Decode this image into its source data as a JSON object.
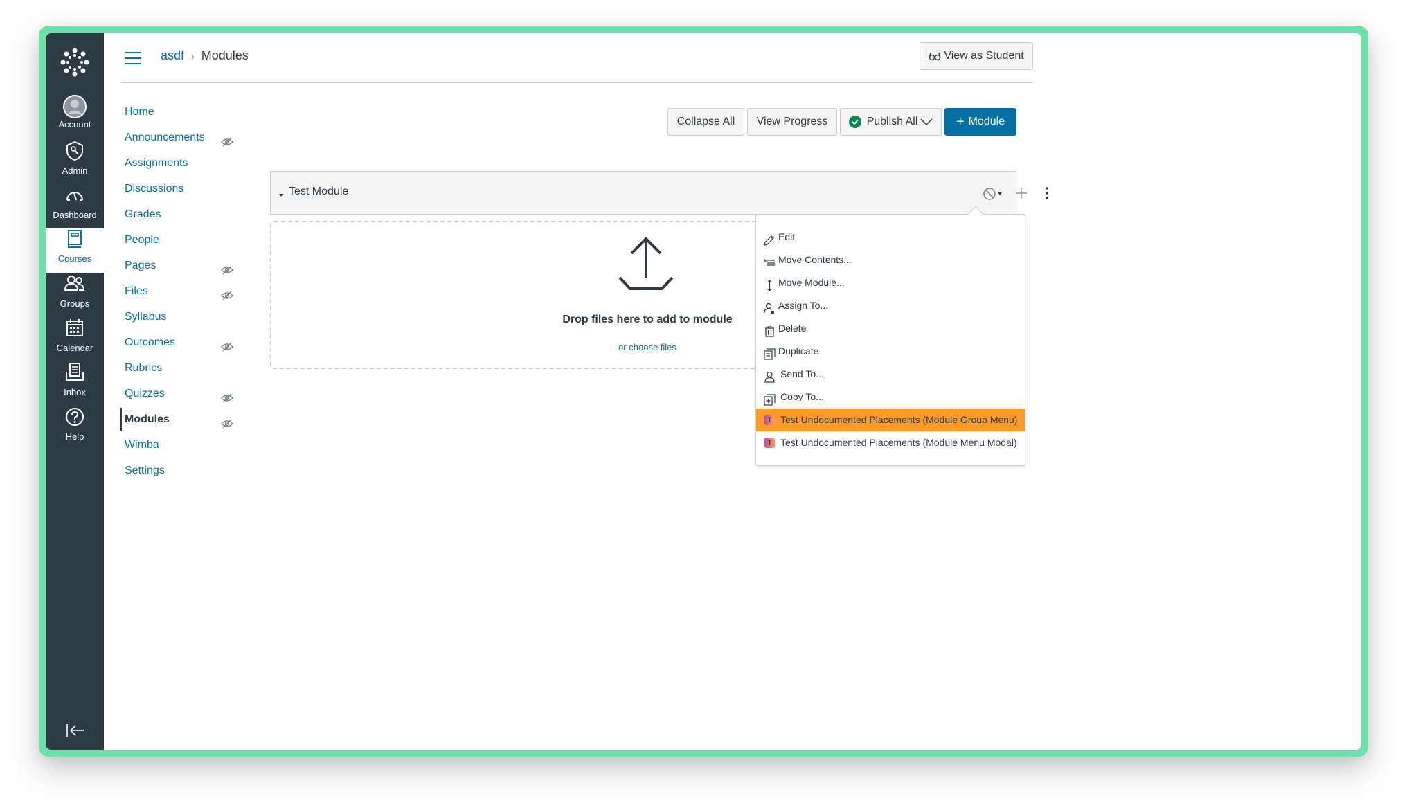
{
  "global_nav": {
    "logo": "canvas-logo-icon",
    "items": [
      {
        "label": "Account",
        "icon": "avatar-icon"
      },
      {
        "label": "Admin",
        "icon": "shield-key-icon"
      },
      {
        "label": "Dashboard",
        "icon": "speedometer-icon"
      },
      {
        "label": "Courses",
        "icon": "book-icon",
        "active": true
      },
      {
        "label": "Groups",
        "icon": "users-icon"
      },
      {
        "label": "Calendar",
        "icon": "calendar-icon"
      },
      {
        "label": "Inbox",
        "icon": "inbox-icon"
      },
      {
        "label": "Help",
        "icon": "question-circle-icon"
      }
    ],
    "collapse_icon": "collapse-nav-icon"
  },
  "header": {
    "breadcrumb": {
      "course": "asdf",
      "separator": "›",
      "page": "Modules"
    },
    "view_as_student": "View as Student"
  },
  "course_nav": [
    {
      "label": "Home",
      "hidden": false
    },
    {
      "label": "Announcements",
      "hidden": true
    },
    {
      "label": "Assignments",
      "hidden": false
    },
    {
      "label": "Discussions",
      "hidden": false
    },
    {
      "label": "Grades",
      "hidden": false
    },
    {
      "label": "People",
      "hidden": false
    },
    {
      "label": "Pages",
      "hidden": true
    },
    {
      "label": "Files",
      "hidden": true
    },
    {
      "label": "Syllabus",
      "hidden": false
    },
    {
      "label": "Outcomes",
      "hidden": true
    },
    {
      "label": "Rubrics",
      "hidden": false
    },
    {
      "label": "Quizzes",
      "hidden": true
    },
    {
      "label": "Modules",
      "hidden": true,
      "active": true
    },
    {
      "label": "Wimba",
      "hidden": false
    },
    {
      "label": "Settings",
      "hidden": false
    }
  ],
  "toolbar": {
    "collapse_all": "Collapse All",
    "view_progress": "View Progress",
    "publish_all": "Publish All",
    "add_module": "Module",
    "add_module_prefix": "+"
  },
  "module": {
    "title": "Test Module",
    "dropzone_title": "Drop files here to add to module",
    "dropzone_link": "or choose files"
  },
  "menu": {
    "items": [
      {
        "label": "Edit",
        "icon": "pencil-icon"
      },
      {
        "label": "Move Contents...",
        "icon": "move-contents-icon"
      },
      {
        "label": "Move Module...",
        "icon": "move-updown-icon"
      },
      {
        "label": "Assign To...",
        "icon": "user-lock-icon"
      },
      {
        "label": "Delete",
        "icon": "trash-icon"
      },
      {
        "label": "Duplicate",
        "icon": "duplicate-icon"
      },
      {
        "label": "Send To...",
        "icon": "user-icon"
      },
      {
        "label": "Copy To...",
        "icon": "copy-to-icon"
      }
    ],
    "tools": [
      {
        "label": "Test Undocumented Placements (Module Group Menu)",
        "badge": "T",
        "highlighted": true
      },
      {
        "label": "Test Undocumented Placements (Module Menu Modal)",
        "badge": "T",
        "highlighted": false
      }
    ],
    "highlight_color": "#fc9a28"
  },
  "colors": {
    "nav_bg": "#2d3b45",
    "link": "#0770a3",
    "primary": "#0770a3",
    "published": "#0b874b",
    "frame": "#6ee0aa"
  }
}
